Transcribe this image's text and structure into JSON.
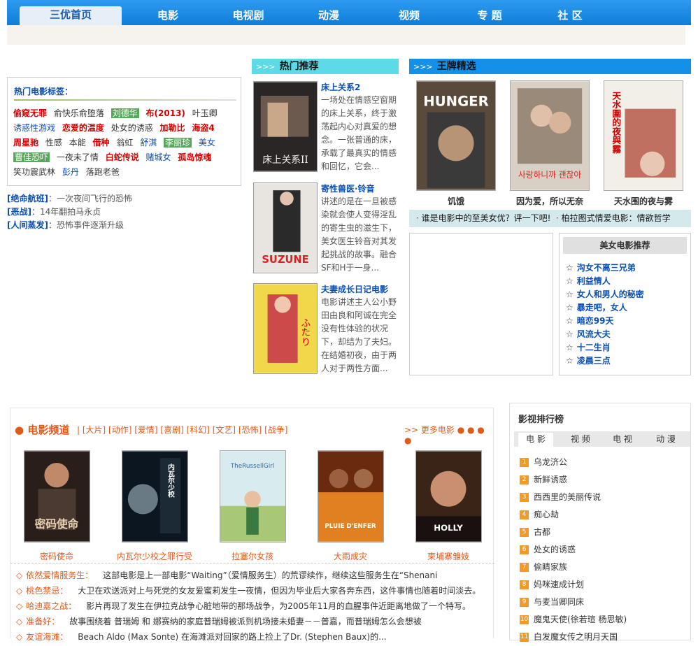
{
  "nav": {
    "tabs": [
      "三优首页",
      "电影",
      "电视剧",
      "动漫",
      "视频",
      "专  题",
      "社  区"
    ]
  },
  "hot": {
    "title": "热门推荐",
    "items": [
      {
        "title": "床上关系2",
        "desc": "一场处在情感空窗期的床上关系，终于激荡起内心对真爱的想念。一张普通的床，承载了最真实的情感和回忆，它会..."
      },
      {
        "title": "寄性兽医·铃音",
        "desc": "讲述的是在一旦被感染就会使人变得淫乱的寄生虫的滋生下，美女医生铃音对其发起挑战的故事。融合SF和H于一身..."
      },
      {
        "title": "夫妻成长日记电影",
        "desc": "电影讲述主人公小野田由良和阿诚在完全没有性体验的状况下，却结为了夫妇。在结婚初夜，由于两人对于两性方面..."
      }
    ]
  },
  "ace": {
    "title": "王牌精选",
    "items": [
      {
        "cap": "饥饿",
        "poster_text": "HUNGER"
      },
      {
        "cap": "因为爱，所以无奈",
        "poster_text": "사랑하니까 괜찮아"
      },
      {
        "cap": "天水围的夜与雾",
        "poster_text": "天水圍的夜與霧"
      }
    ],
    "links": [
      "谁是电影中的至美女优？评一下吧!",
      "柏拉图式情爱电影：情欲哲学"
    ]
  },
  "tags": {
    "title": "热门电影标签：",
    "items": [
      {
        "t": "偷窥无罪",
        "s": "rb"
      },
      {
        "t": "俞快乐俞堕落",
        "s": ""
      },
      {
        "t": "刘德华",
        "s": "hl"
      },
      {
        "t": "布(2013)",
        "s": "rb"
      },
      {
        "t": "叶玉卿",
        "s": ""
      },
      {
        "t": "诱惑性游戏",
        "s": "blue"
      },
      {
        "t": "恋爱的温度",
        "s": "rb"
      },
      {
        "t": "处女的诱惑",
        "s": ""
      },
      {
        "t": "加勒比",
        "s": "rb"
      },
      {
        "t": "海盗4",
        "s": "rb"
      },
      {
        "t": "周星驰",
        "s": "rb"
      },
      {
        "t": "性感",
        "s": ""
      },
      {
        "t": "本能",
        "s": ""
      },
      {
        "t": "借种",
        "s": "rb"
      },
      {
        "t": "翁虹",
        "s": ""
      },
      {
        "t": "舒淇",
        "s": "blue"
      },
      {
        "t": "李丽珍",
        "s": "hl"
      },
      {
        "t": "美女",
        "s": "blue"
      },
      {
        "t": "曹佳恐吓",
        "s": "hl"
      },
      {
        "t": "一夜未了情",
        "s": ""
      },
      {
        "t": "白蛇传说",
        "s": "rb"
      },
      {
        "t": "赌城女",
        "s": "blue"
      },
      {
        "t": "孤岛惊魂",
        "s": "rb"
      },
      {
        "t": "笑功震武林",
        "s": ""
      },
      {
        "t": "彭丹",
        "s": "blue"
      },
      {
        "t": "落跑老爸",
        "s": ""
      }
    ]
  },
  "recs": [
    {
      "k": "[绝命航班]",
      "v": "：一次夜间飞行的恐怖"
    },
    {
      "k": "[恶战]",
      "v": "：14年翻拍马永贞"
    },
    {
      "k": "[人间蒸发]",
      "v": "：恐怖事件逐渐升级"
    }
  ],
  "beauty": {
    "title": "美女电影推荐",
    "items": [
      "沟女不离三兄弟",
      "利益情人",
      "女人和男人的秘密",
      "暴走吧，女人",
      "暗恋99天",
      "风流大夫",
      "十二生肖",
      "凌晨三点"
    ]
  },
  "channel": {
    "title": "电影频道",
    "cats": "| [大片] [动作] [爱情] [喜剧] [科幻] [文艺] [恐怖] [战争]",
    "more": ">> 更多电影 ● ● ● ●",
    "films": [
      {
        "cap": "密码使命",
        "poster_text": "密码使命"
      },
      {
        "cap": "内瓦尔少校之罪行受",
        "poster_text": "内瓦尔少校"
      },
      {
        "cap": "拉塞尔女孩",
        "poster_text": "TheRussellGirl"
      },
      {
        "cap": "大雨成灾",
        "poster_text": "PLUIE D'ENFER"
      },
      {
        "cap": "柬埔寨雏妓",
        "poster_text": "HOLLY"
      }
    ],
    "news": [
      {
        "t": "依然爱情服务生：",
        "d": "这部电影是上一部电影“Waiting”（爱情服务生）的荒谬续作，继续这些服务生在“Shenani"
      },
      {
        "t": "桃色禁忌：",
        "d": "大卫在欢送派对上与死党的女友爱蜜莉发生一夜情，但因为毕业后大家各奔东西，这件事情也随着时间淡去。"
      },
      {
        "t": "哈迪嘉之战：",
        "d": "影片再现了发生在伊拉克战争心脏地带的那场战争，为2005年11月的血腥事件近距离地做了一个特写。"
      },
      {
        "t": "准备好：",
        "d": "故事围绕着 普瑞姆 和 娜赛纳的家庭普瑞姆被派到机场接未婚妻－－普嘉，而普瑞姆怎么会想被"
      },
      {
        "t": "友谊海滩：",
        "d": "Beach Aldo (Max Sonte) 在海滩派对回家的路上捡上了Dr. (Stephen Baux)的..."
      }
    ]
  },
  "rank": {
    "title": "影视排行榜",
    "tabs": [
      "电 影",
      "视 频",
      "电 视",
      "动 漫"
    ],
    "items": [
      "乌龙济公",
      "新鲜诱惑",
      "西西里的美丽传说",
      "痴心劫",
      "古都",
      "处女的诱惑",
      "偷睛家族",
      "妈咪速成计划",
      "与麦当卿同床",
      "魔鬼天使(徐若瑄 杨思敏)",
      "白发魔女传之明月天国"
    ]
  }
}
